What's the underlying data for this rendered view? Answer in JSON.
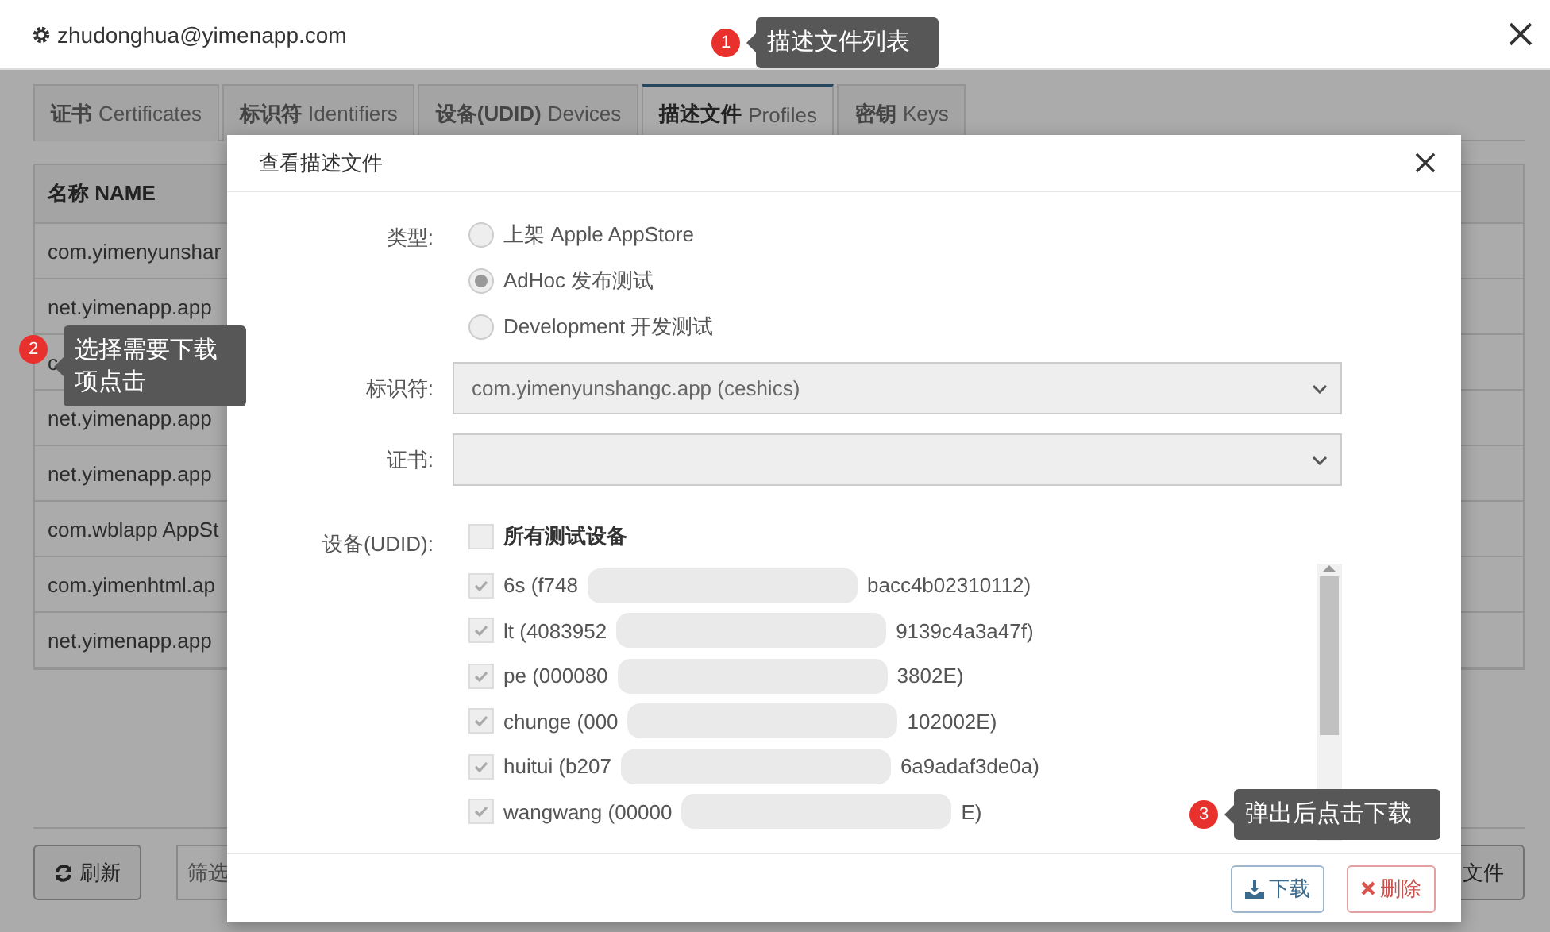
{
  "window": {
    "title": "zhudonghua@yimenapp.com"
  },
  "tabs": [
    {
      "zh": "证书",
      "en": "Certificates",
      "selected": false
    },
    {
      "zh": "标识符",
      "en": "Identifiers",
      "selected": false
    },
    {
      "zh": "设备(UDID)",
      "en": "Devices",
      "selected": false
    },
    {
      "zh": "描述文件",
      "en": "Profiles",
      "selected": true
    },
    {
      "zh": "密钥",
      "en": "Keys",
      "selected": false
    }
  ],
  "table": {
    "columns": [
      "名称 NAME"
    ],
    "rows": [
      "com.yimenyunshar",
      "net.yimenapp.app",
      "c",
      "net.yimenapp.app",
      "net.yimenapp.app",
      "com.wblapp AppSt",
      "com.yimenhtml.ap",
      "net.yimenapp.app"
    ]
  },
  "footer": {
    "refresh": "刷新",
    "filter_placeholder": "筛选",
    "right_button": "文件"
  },
  "dialog": {
    "title": "查看描述文件",
    "type": {
      "label": "类型:",
      "options": [
        {
          "label": "上架 Apple AppStore",
          "selected": false
        },
        {
          "label": "AdHoc 发布测试",
          "selected": true
        },
        {
          "label": "Development 开发测试",
          "selected": false
        }
      ]
    },
    "identifier": {
      "label": "标识符:",
      "value": "com.yimenyunshangc.app (ceshics)"
    },
    "certificate": {
      "label": "证书:"
    },
    "devices": {
      "label": "设备(UDID):",
      "all": {
        "label": "所有测试设备",
        "checked": false
      },
      "items": [
        {
          "start": "6s (f748",
          "end": "bacc4b02310112)",
          "checked": true
        },
        {
          "start": "lt (4083952",
          "end": "9139c4a3a47f)",
          "checked": true
        },
        {
          "start": "pe (000080",
          "end": "3802E)",
          "checked": true
        },
        {
          "start": "chunge (000",
          "end": "102002E)",
          "checked": true
        },
        {
          "start": "huitui (b207",
          "end": "6a9adaf3de0a)",
          "checked": true
        },
        {
          "start": "wangwang (00000",
          "end": "E)",
          "checked": true
        }
      ]
    },
    "buttons": [
      {
        "label": "下载",
        "kind": "download"
      },
      {
        "label": "删除",
        "kind": "delete"
      }
    ]
  },
  "annotations": [
    {
      "number": "1",
      "text": "描述文件列表"
    },
    {
      "number": "2",
      "text": "选择需要下载项点击"
    },
    {
      "number": "3",
      "text": "弹出后点击下载"
    }
  ]
}
